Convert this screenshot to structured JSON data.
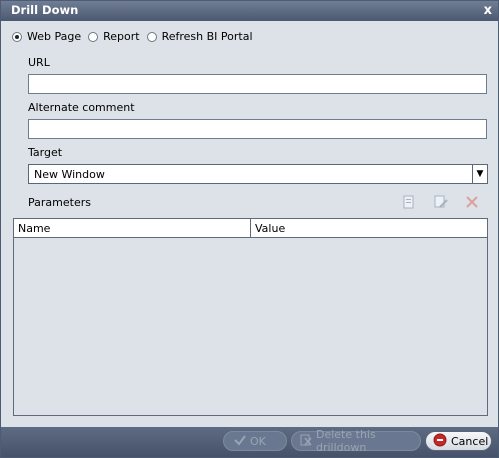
{
  "dialog": {
    "title": "Drill Down",
    "close_glyph": "x",
    "radio_options": [
      {
        "label": "Web Page",
        "checked": true
      },
      {
        "label": "Report",
        "checked": false
      },
      {
        "label": "Refresh BI Portal",
        "checked": false
      }
    ],
    "url_label": "URL",
    "url_value": "",
    "comment_label": "Alternate comment",
    "comment_value": "",
    "target_label": "Target",
    "target_value": "New Window",
    "parameters_label": "Parameters",
    "toolbar_icons": [
      "add-parameter-icon",
      "edit-parameter-icon",
      "delete-parameter-icon"
    ],
    "table": {
      "columns": [
        "Name",
        "Value"
      ],
      "rows": []
    },
    "buttons": {
      "ok": "OK",
      "delete": "Delete this drilldown",
      "cancel": "Cancel"
    },
    "colors": {
      "title_bar": "#4c5970",
      "background": "#dde2e8",
      "footer": "#4b576f",
      "cancel_icon": "#c62828"
    }
  }
}
